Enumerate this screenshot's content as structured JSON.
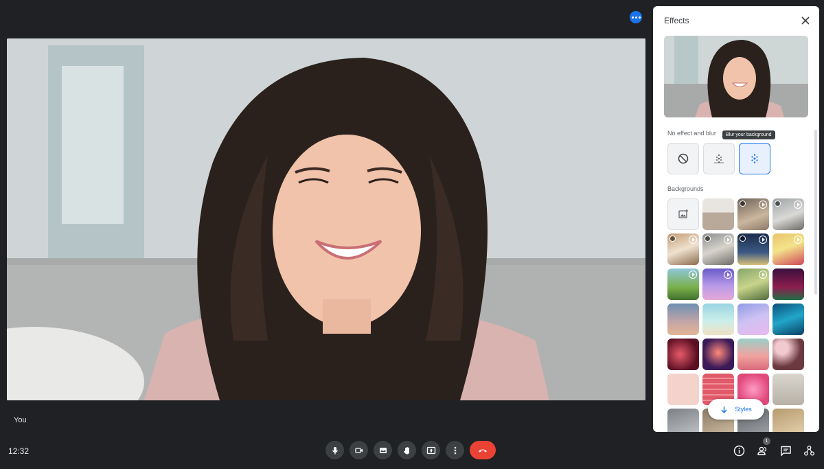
{
  "participant": {
    "name": "You"
  },
  "clock": "12:32",
  "panel": {
    "title": "Effects",
    "no_effect_label": "No effect and blur",
    "tooltip": "Blur your background",
    "backgrounds_label": "Backgrounds",
    "styles_button": "Styles"
  },
  "participants_count": "1",
  "colors": {
    "accent": "#1a73e8",
    "end_call": "#ea4335",
    "control_bg": "#3c4043",
    "page_bg": "#202124"
  },
  "controls": [
    "microphone-icon",
    "camera-icon",
    "captions-icon",
    "raise-hand-icon",
    "present-icon",
    "more-options-icon",
    "end-call-icon"
  ]
}
